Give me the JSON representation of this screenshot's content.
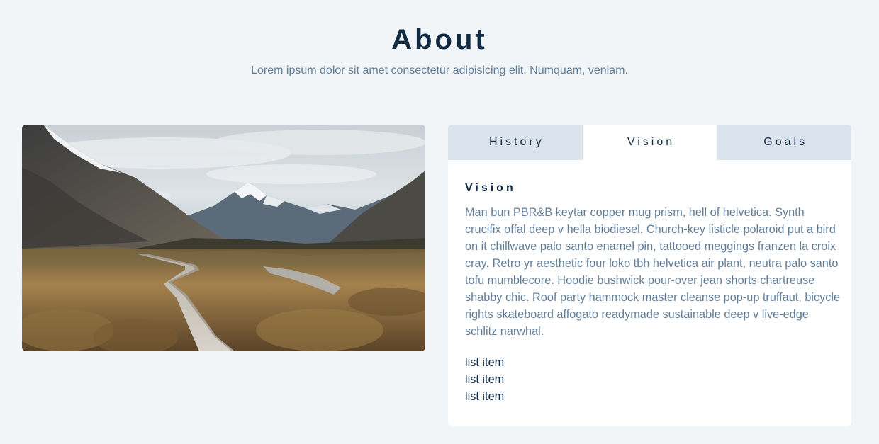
{
  "header": {
    "title": "About",
    "subtitle": "Lorem ipsum dolor sit amet consectetur adipisicing elit. Numquam, veniam."
  },
  "image": {
    "description_icon": "mountain-landscape-image"
  },
  "tabs": [
    {
      "label": "History",
      "active": false
    },
    {
      "label": "Vision",
      "active": true
    },
    {
      "label": "Goals",
      "active": false
    }
  ],
  "content": {
    "title": "Vision",
    "text": "Man bun PBR&B keytar copper mug prism, hell of helvetica. Synth crucifix offal deep v hella biodiesel. Church-key listicle polaroid put a bird on it chillwave palo santo enamel pin, tattooed meggings franzen la croix cray. Retro yr aesthetic four loko tbh helvetica air plant, neutra palo santo tofu mumblecore. Hoodie bushwick pour-over jean shorts chartreuse shabby chic. Roof party hammock master cleanse pop-up truffaut, bicycle rights skateboard affogato readymade sustainable deep v live-edge schlitz narwhal.",
    "list": [
      "list item",
      "list item",
      "list item"
    ]
  },
  "colors": {
    "background": "#f1f5f8",
    "heading": "#102a42",
    "muted_text": "#617d98",
    "tab_inactive": "#dbe3ec",
    "panel": "#ffffff"
  }
}
